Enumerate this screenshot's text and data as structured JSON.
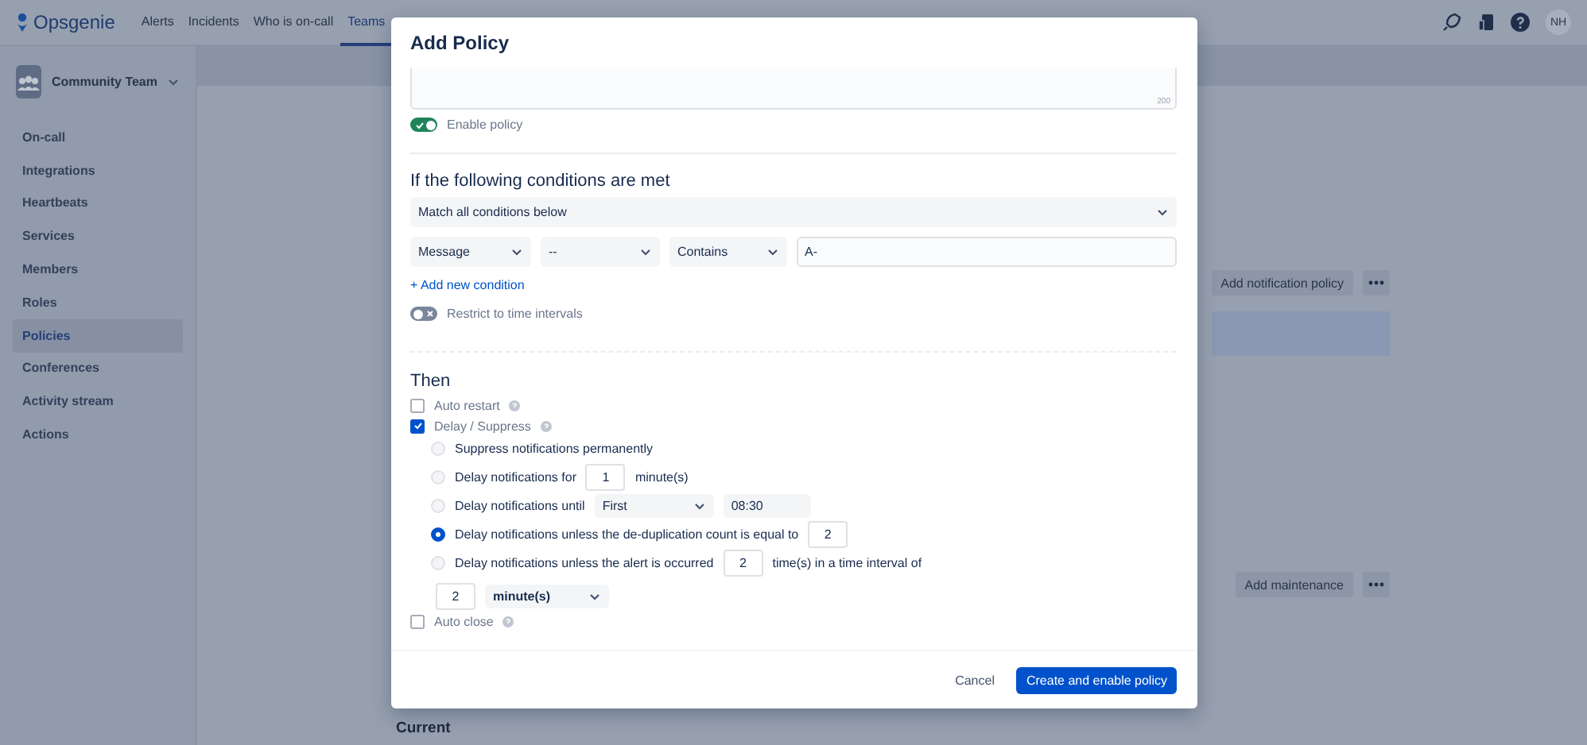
{
  "nav": {
    "logo": "Opsgenie",
    "tabs": [
      {
        "label": "Alerts",
        "selected": false
      },
      {
        "label": "Incidents",
        "selected": false
      },
      {
        "label": "Who is on-call",
        "selected": false
      },
      {
        "label": "Teams",
        "selected": true
      }
    ],
    "avatar": "NH"
  },
  "sidebar": {
    "team": "Community Team",
    "items": [
      {
        "label": "On-call",
        "selected": false
      },
      {
        "label": "Integrations",
        "selected": false
      },
      {
        "label": "Heartbeats",
        "selected": false
      },
      {
        "label": "Services",
        "selected": false
      },
      {
        "label": "Members",
        "selected": false
      },
      {
        "label": "Roles",
        "selected": false
      },
      {
        "label": "Policies",
        "selected": true
      },
      {
        "label": "Conferences",
        "selected": false
      },
      {
        "label": "Activity stream",
        "selected": false
      },
      {
        "label": "Actions",
        "selected": false
      }
    ]
  },
  "page": {
    "notification_button": "Add notification policy",
    "maintenance_button": "Add maintenance",
    "section_title": "Current"
  },
  "modal": {
    "title": "Add Policy",
    "description_counter": "200",
    "enable_policy": {
      "label": "Enable policy",
      "on": true
    },
    "conditions_title": "If the following conditions are met",
    "match": "Match all conditions below",
    "condition": {
      "field": "Message",
      "subfield": "--",
      "operator": "Contains",
      "value": "A-"
    },
    "add_condition": "+ Add new condition",
    "restrict": {
      "label": "Restrict to time intervals",
      "on": false
    },
    "then_title": "Then",
    "actions": [
      {
        "label": "Auto restart",
        "checked": false
      },
      {
        "label": "Delay / Suppress",
        "checked": true,
        "options": [
          {
            "kind": "plain",
            "label": "Suppress notifications permanently",
            "selected": false
          },
          {
            "kind": "duration",
            "label": "Delay notifications for",
            "value": "1",
            "unit": "minute(s)",
            "selected": false
          },
          {
            "kind": "until",
            "label": "Delay notifications until",
            "day": "First",
            "time": "08:30",
            "selected": false
          },
          {
            "kind": "count",
            "label": "Delay notifications unless the de-duplication count is equal to",
            "value": "2",
            "selected": true
          },
          {
            "kind": "occurrence",
            "label": "Delay notifications unless the alert is occurred",
            "count": "2",
            "suffix": "time(s) in a time interval of",
            "interval": "2",
            "unit": "minute(s)",
            "selected": false
          }
        ]
      },
      {
        "label": "Auto close",
        "checked": false
      }
    ],
    "cancel": "Cancel",
    "submit": "Create and enable policy"
  }
}
